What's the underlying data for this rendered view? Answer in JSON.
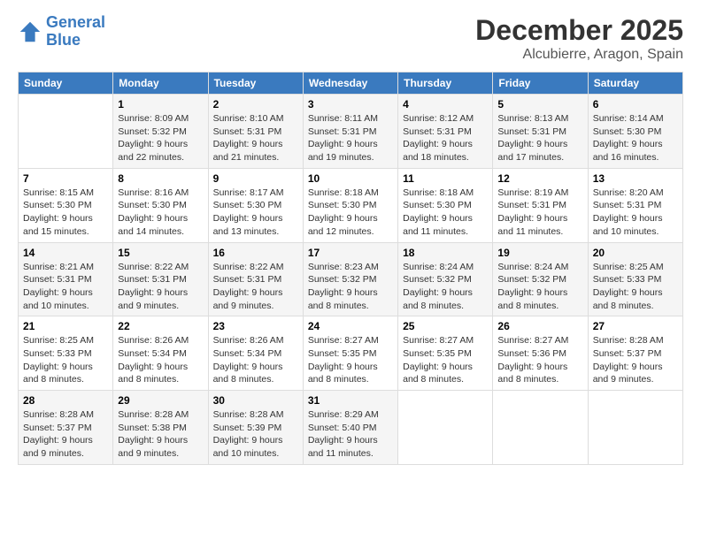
{
  "logo": {
    "line1": "General",
    "line2": "Blue"
  },
  "title": "December 2025",
  "subtitle": "Alcubierre, Aragon, Spain",
  "days_of_week": [
    "Sunday",
    "Monday",
    "Tuesday",
    "Wednesday",
    "Thursday",
    "Friday",
    "Saturday"
  ],
  "weeks": [
    [
      {
        "day": "",
        "info": ""
      },
      {
        "day": "1",
        "info": "Sunrise: 8:09 AM\nSunset: 5:32 PM\nDaylight: 9 hours\nand 22 minutes."
      },
      {
        "day": "2",
        "info": "Sunrise: 8:10 AM\nSunset: 5:31 PM\nDaylight: 9 hours\nand 21 minutes."
      },
      {
        "day": "3",
        "info": "Sunrise: 8:11 AM\nSunset: 5:31 PM\nDaylight: 9 hours\nand 19 minutes."
      },
      {
        "day": "4",
        "info": "Sunrise: 8:12 AM\nSunset: 5:31 PM\nDaylight: 9 hours\nand 18 minutes."
      },
      {
        "day": "5",
        "info": "Sunrise: 8:13 AM\nSunset: 5:31 PM\nDaylight: 9 hours\nand 17 minutes."
      },
      {
        "day": "6",
        "info": "Sunrise: 8:14 AM\nSunset: 5:30 PM\nDaylight: 9 hours\nand 16 minutes."
      }
    ],
    [
      {
        "day": "7",
        "info": "Sunrise: 8:15 AM\nSunset: 5:30 PM\nDaylight: 9 hours\nand 15 minutes."
      },
      {
        "day": "8",
        "info": "Sunrise: 8:16 AM\nSunset: 5:30 PM\nDaylight: 9 hours\nand 14 minutes."
      },
      {
        "day": "9",
        "info": "Sunrise: 8:17 AM\nSunset: 5:30 PM\nDaylight: 9 hours\nand 13 minutes."
      },
      {
        "day": "10",
        "info": "Sunrise: 8:18 AM\nSunset: 5:30 PM\nDaylight: 9 hours\nand 12 minutes."
      },
      {
        "day": "11",
        "info": "Sunrise: 8:18 AM\nSunset: 5:30 PM\nDaylight: 9 hours\nand 11 minutes."
      },
      {
        "day": "12",
        "info": "Sunrise: 8:19 AM\nSunset: 5:31 PM\nDaylight: 9 hours\nand 11 minutes."
      },
      {
        "day": "13",
        "info": "Sunrise: 8:20 AM\nSunset: 5:31 PM\nDaylight: 9 hours\nand 10 minutes."
      }
    ],
    [
      {
        "day": "14",
        "info": "Sunrise: 8:21 AM\nSunset: 5:31 PM\nDaylight: 9 hours\nand 10 minutes."
      },
      {
        "day": "15",
        "info": "Sunrise: 8:22 AM\nSunset: 5:31 PM\nDaylight: 9 hours\nand 9 minutes."
      },
      {
        "day": "16",
        "info": "Sunrise: 8:22 AM\nSunset: 5:31 PM\nDaylight: 9 hours\nand 9 minutes."
      },
      {
        "day": "17",
        "info": "Sunrise: 8:23 AM\nSunset: 5:32 PM\nDaylight: 9 hours\nand 8 minutes."
      },
      {
        "day": "18",
        "info": "Sunrise: 8:24 AM\nSunset: 5:32 PM\nDaylight: 9 hours\nand 8 minutes."
      },
      {
        "day": "19",
        "info": "Sunrise: 8:24 AM\nSunset: 5:32 PM\nDaylight: 9 hours\nand 8 minutes."
      },
      {
        "day": "20",
        "info": "Sunrise: 8:25 AM\nSunset: 5:33 PM\nDaylight: 9 hours\nand 8 minutes."
      }
    ],
    [
      {
        "day": "21",
        "info": "Sunrise: 8:25 AM\nSunset: 5:33 PM\nDaylight: 9 hours\nand 8 minutes."
      },
      {
        "day": "22",
        "info": "Sunrise: 8:26 AM\nSunset: 5:34 PM\nDaylight: 9 hours\nand 8 minutes."
      },
      {
        "day": "23",
        "info": "Sunrise: 8:26 AM\nSunset: 5:34 PM\nDaylight: 9 hours\nand 8 minutes."
      },
      {
        "day": "24",
        "info": "Sunrise: 8:27 AM\nSunset: 5:35 PM\nDaylight: 9 hours\nand 8 minutes."
      },
      {
        "day": "25",
        "info": "Sunrise: 8:27 AM\nSunset: 5:35 PM\nDaylight: 9 hours\nand 8 minutes."
      },
      {
        "day": "26",
        "info": "Sunrise: 8:27 AM\nSunset: 5:36 PM\nDaylight: 9 hours\nand 8 minutes."
      },
      {
        "day": "27",
        "info": "Sunrise: 8:28 AM\nSunset: 5:37 PM\nDaylight: 9 hours\nand 9 minutes."
      }
    ],
    [
      {
        "day": "28",
        "info": "Sunrise: 8:28 AM\nSunset: 5:37 PM\nDaylight: 9 hours\nand 9 minutes."
      },
      {
        "day": "29",
        "info": "Sunrise: 8:28 AM\nSunset: 5:38 PM\nDaylight: 9 hours\nand 9 minutes."
      },
      {
        "day": "30",
        "info": "Sunrise: 8:28 AM\nSunset: 5:39 PM\nDaylight: 9 hours\nand 10 minutes."
      },
      {
        "day": "31",
        "info": "Sunrise: 8:29 AM\nSunset: 5:40 PM\nDaylight: 9 hours\nand 11 minutes."
      },
      {
        "day": "",
        "info": ""
      },
      {
        "day": "",
        "info": ""
      },
      {
        "day": "",
        "info": ""
      }
    ]
  ]
}
